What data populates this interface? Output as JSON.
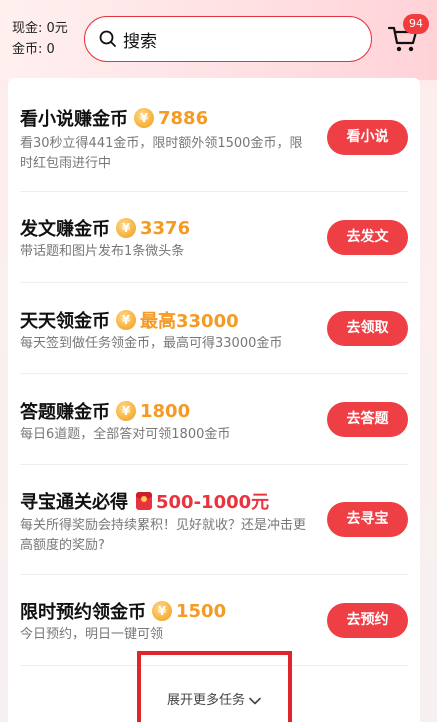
{
  "header": {
    "cash": "现金: 0元",
    "coins": "金币: 0",
    "search_label": "搜索",
    "cart_badge": "94"
  },
  "coin_symbol": "¥",
  "tasks": [
    {
      "title": "看小说赚金币",
      "reward": "7886",
      "reward_icon": "coin-icon",
      "desc": "看30秒立得441金币，限时额外领1500金币，限时红包雨进行中",
      "button": "看小说"
    },
    {
      "title": "发文赚金币",
      "reward": "3376",
      "reward_icon": "coin-icon",
      "desc": "带话题和图片发布1条微头条",
      "button": "去发文"
    },
    {
      "title": "天天领金币",
      "reward": "最高33000",
      "reward_icon": "coin-icon",
      "desc": "每天签到做任务领金币，最高可得33000金币",
      "button": "去领取"
    },
    {
      "title": "答题赚金币",
      "reward": "1800",
      "reward_icon": "coin-icon",
      "desc": "每日6道题，全部答对可领1800金币",
      "button": "去答题"
    },
    {
      "title": "寻宝通关必得",
      "reward": "500-1000元",
      "reward_icon": "red-packet-icon",
      "desc": "每关所得奖励会持续累积！见好就收？还是冲击更高额度的奖励?",
      "button": "去寻宝"
    },
    {
      "title": "限时预约领金币",
      "reward": "1500",
      "reward_icon": "coin-icon",
      "desc": "今日预约，明日一键可领",
      "button": "去预约"
    }
  ],
  "expand_label": "展开更多任务",
  "colors": {
    "accent": "#ee3f45",
    "coin_text": "#f59a23",
    "highlight_frame": "#e0262b"
  }
}
